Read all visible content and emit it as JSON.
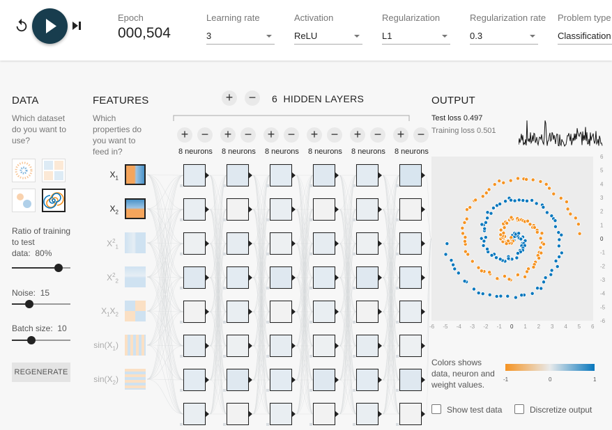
{
  "controls": {
    "reset_icon": "reset-icon",
    "play_icon": "play-icon",
    "step_icon": "step-forward-icon"
  },
  "epoch": {
    "label": "Epoch",
    "value": "000,504"
  },
  "learning_rate": {
    "label": "Learning rate",
    "value": "3"
  },
  "activation": {
    "label": "Activation",
    "value": "ReLU"
  },
  "regularization": {
    "label": "Regularization",
    "value": "L1"
  },
  "regularization_rate": {
    "label": "Regularization rate",
    "value": "0.3"
  },
  "problem_type": {
    "label": "Problem type",
    "value": "Classification"
  },
  "data": {
    "heading": "DATA",
    "question_lines": [
      "Which dataset",
      "do you want to",
      "use?"
    ],
    "datasets": [
      "circle",
      "xor",
      "gaussian",
      "spiral"
    ],
    "selected_dataset": "spiral",
    "ratio_lines": [
      "Ratio of training",
      "to test"
    ],
    "ratio_label": "data:",
    "ratio_value": "80%",
    "ratio_fraction": 0.8,
    "noise_label": "Noise:",
    "noise_value": "15",
    "noise_fraction": 0.3,
    "batch_label": "Batch size:",
    "batch_value": "10",
    "batch_fraction": 0.33,
    "regenerate": "REGENERATE"
  },
  "features": {
    "heading": "FEATURES",
    "question_lines": [
      "Which",
      "properties do",
      "you want to",
      "feed in?"
    ],
    "items": [
      {
        "base": "X",
        "sub": "1",
        "sup": "",
        "tail": "",
        "active": true
      },
      {
        "base": "X",
        "sub": "2",
        "sup": "",
        "tail": "",
        "active": true
      },
      {
        "base": "X",
        "sub": "1",
        "sup": "2",
        "tail": "",
        "active": false
      },
      {
        "base": "X",
        "sub": "2",
        "sup": "2",
        "tail": "",
        "active": false
      },
      {
        "base": "X",
        "sub": "1",
        "sup": "",
        "tail": "X",
        "sub2": "2",
        "active": false
      },
      {
        "base": "sin(X",
        "sub": "1",
        "sup": "",
        "tail": ")",
        "active": false
      },
      {
        "base": "sin(X",
        "sub": "2",
        "sup": "",
        "tail": ")",
        "active": false
      }
    ]
  },
  "network": {
    "layer_count": "6",
    "title": "HIDDEN LAYERS",
    "plus": "+",
    "minus": "−",
    "neuron_labels": [
      "8 neurons",
      "8 neurons",
      "8 neurons",
      "8 neurons",
      "8 neurons",
      "8 neurons"
    ]
  },
  "output": {
    "heading": "OUTPUT",
    "test_loss_label": "Test loss",
    "test_loss_value": "0.497",
    "training_loss_label": "Training loss",
    "training_loss_value": "0.501",
    "x_ticks": [
      "-6",
      "-5",
      "-4",
      "-3",
      "-2",
      "-1",
      "0",
      "1",
      "2",
      "3",
      "4",
      "5",
      "6"
    ],
    "y_ticks": [
      "6",
      "5",
      "4",
      "3",
      "2",
      "1",
      "0",
      "-1",
      "-2",
      "-3",
      "-4",
      "-5",
      "-6"
    ],
    "colors_lines": [
      "Colors shows",
      "data, neuron and",
      "weight values."
    ],
    "gradient_ticks": [
      "-1",
      "0",
      "1"
    ],
    "colors": {
      "negative": "#f59322",
      "positive": "#0877bd",
      "neutral": "#e8eaeb"
    },
    "show_test_data": "Show test data",
    "discretize_output": "Discretize output"
  }
}
